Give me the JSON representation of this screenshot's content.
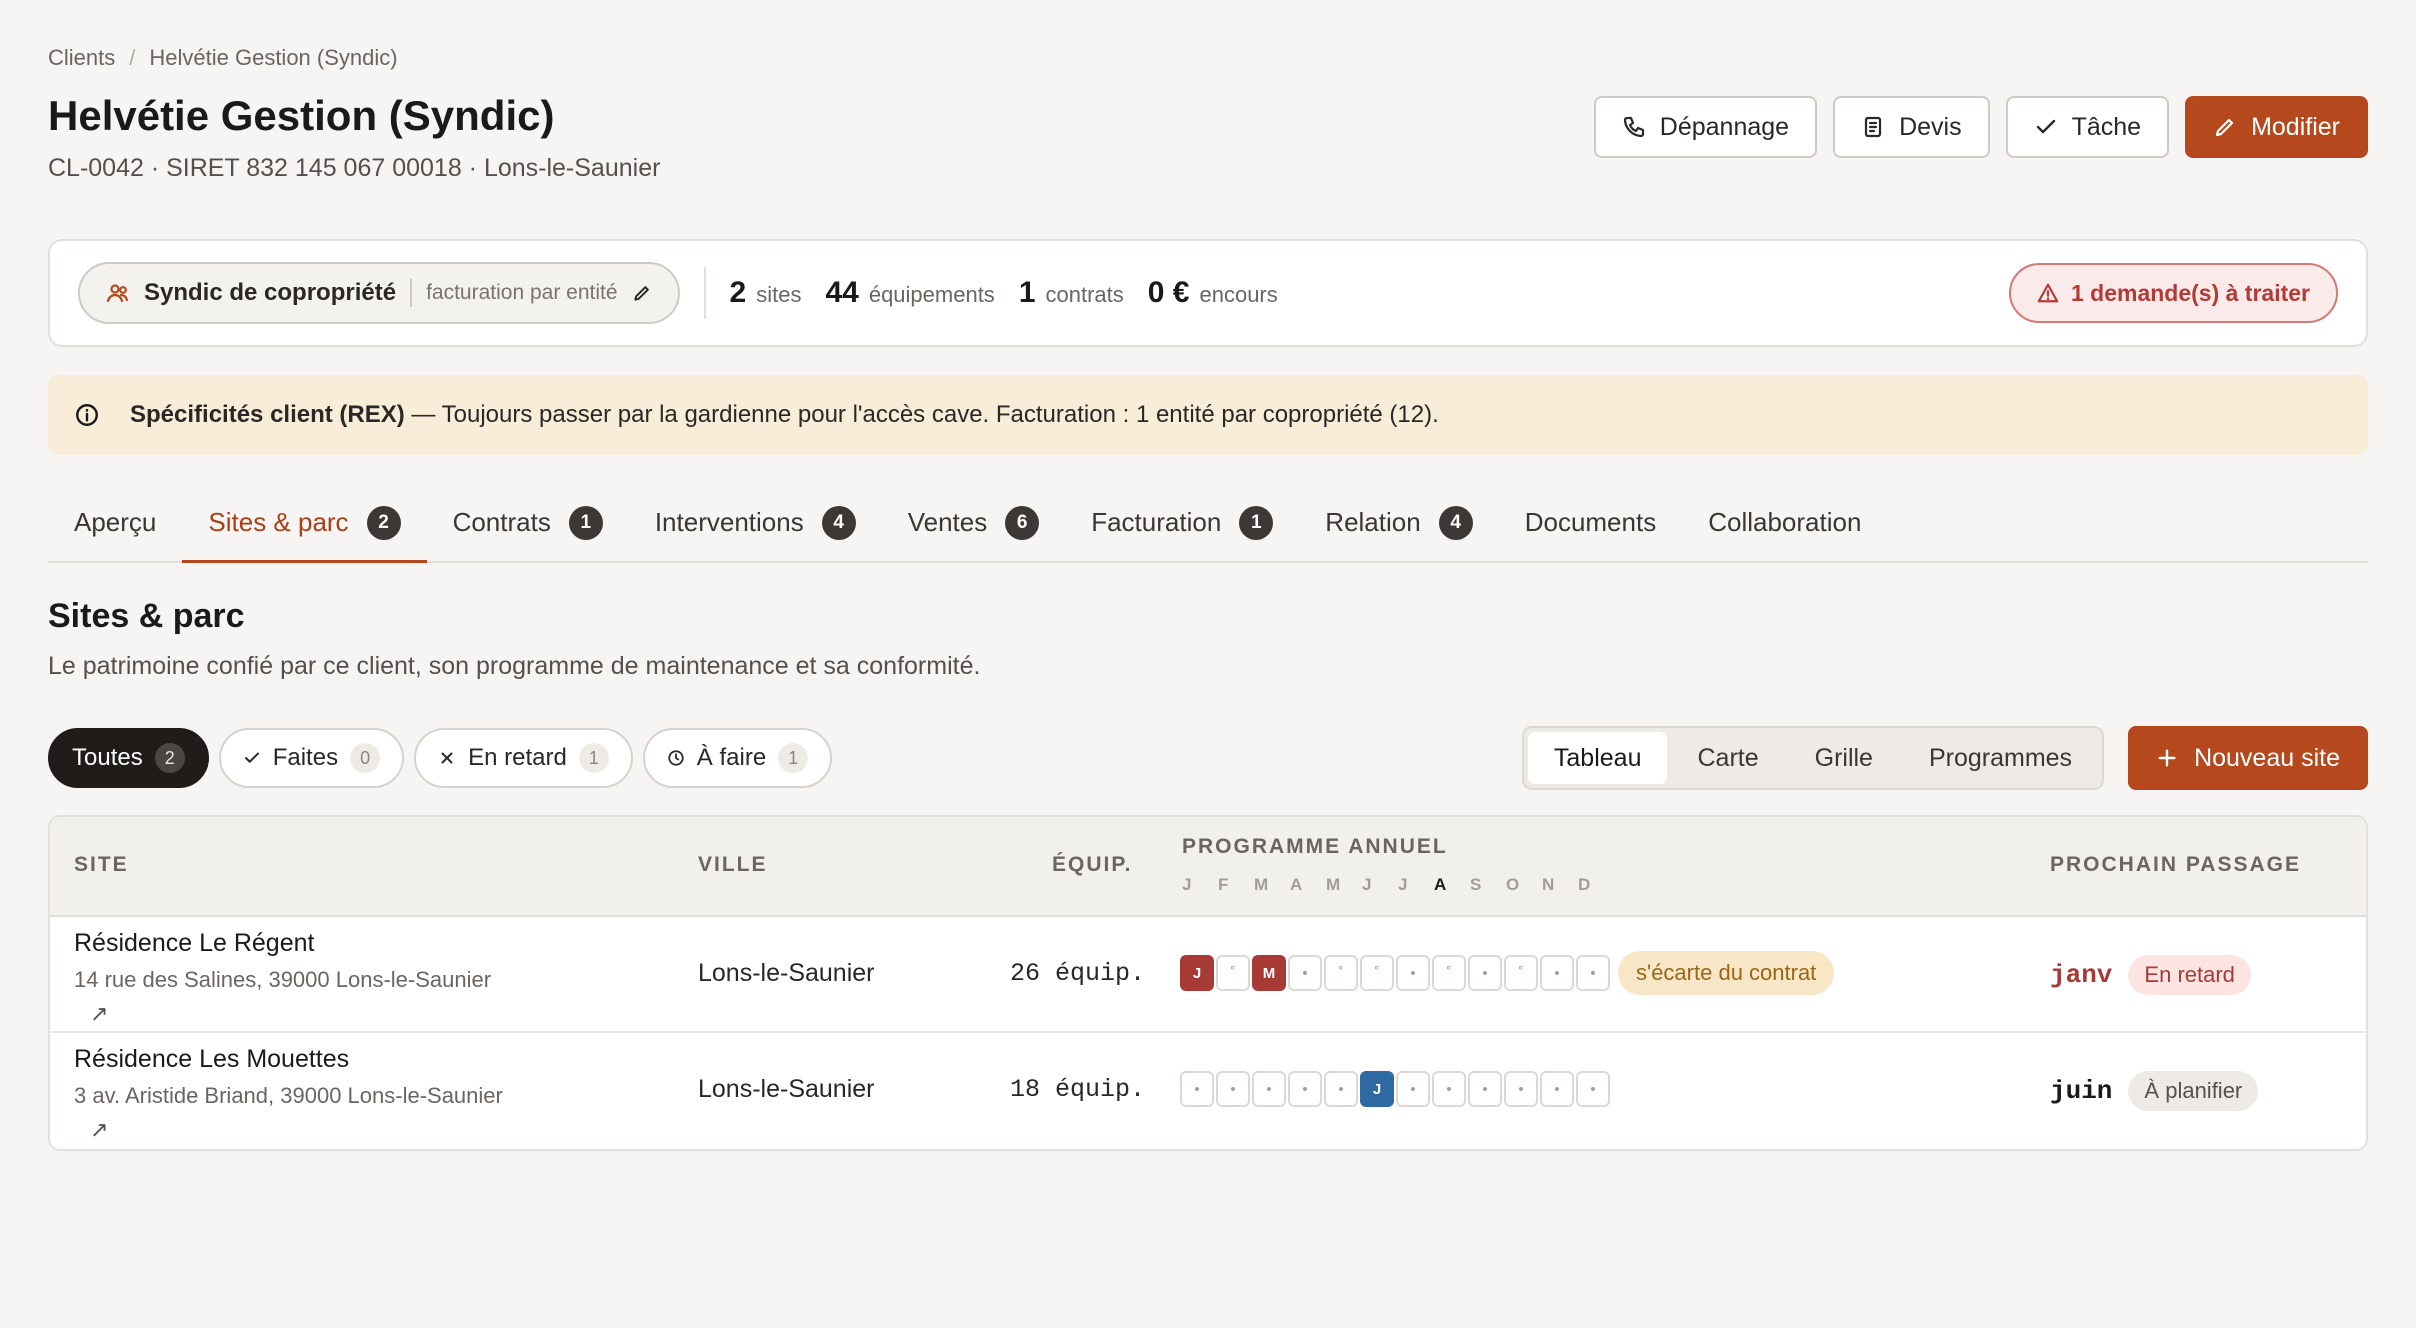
{
  "breadcrumb": [
    "Clients",
    "Helvétie Gestion (Syndic)"
  ],
  "client": {
    "name": "Helvétie Gestion (Syndic)",
    "meta": "CL-0042 · SIRET 832 145 067 00018 · Lons-le-Saunier"
  },
  "actions": {
    "depannage": "Dépannage",
    "devis": "Devis",
    "tache": "Tâche",
    "modifier": "Modifier"
  },
  "summary": {
    "type_label": "Syndic de copropriété",
    "billing_label": "facturation par entité",
    "stats": [
      {
        "n": "2",
        "u": "sites"
      },
      {
        "n": "44",
        "u": "équipements"
      },
      {
        "n": "1",
        "u": "contrats"
      },
      {
        "n": "0 €",
        "u": "encours"
      }
    ],
    "alert": "1 demande(s) à traiter"
  },
  "rex": {
    "title": "Spécificités client (REX)",
    "text": "— Toujours passer par la gardienne pour l'accès cave. Facturation : 1 entité par copropriété (12)."
  },
  "tabs": [
    {
      "label": "Aperçu",
      "count": ""
    },
    {
      "label": "Sites & parc",
      "count": "2",
      "active": true
    },
    {
      "label": "Contrats",
      "count": "1"
    },
    {
      "label": "Interventions",
      "count": "4"
    },
    {
      "label": "Ventes",
      "count": "6"
    },
    {
      "label": "Facturation",
      "count": "1"
    },
    {
      "label": "Relation",
      "count": "4"
    },
    {
      "label": "Documents",
      "count": ""
    },
    {
      "label": "Collaboration",
      "count": ""
    }
  ],
  "section": {
    "title": "Sites & parc",
    "desc": "Le patrimoine confié par ce client, son programme de maintenance et sa conformité."
  },
  "filters": [
    {
      "label": "Toutes",
      "count": "2",
      "icon": ""
    },
    {
      "label": "Faites",
      "count": "0",
      "icon": "check-icon"
    },
    {
      "label": "En retard",
      "count": "1",
      "icon": "x-icon"
    },
    {
      "label": "À faire",
      "count": "1",
      "icon": "clock-icon"
    }
  ],
  "views": [
    "Tableau",
    "Carte",
    "Grille",
    "Programmes"
  ],
  "new_site": "Nouveau site",
  "table": {
    "headers": {
      "site": "SITE",
      "ville": "VILLE",
      "equip": "ÉQUIP.",
      "programme": "PROGRAMME ANNUEL",
      "prochain": "PROCHAIN PASSAGE"
    },
    "months": [
      "J",
      "F",
      "M",
      "A",
      "M",
      "J",
      "J",
      "A",
      "S",
      "O",
      "N",
      "D"
    ],
    "current_month_index": 7,
    "rows": [
      {
        "site": "Résidence Le Régent",
        "address": "14 rue des Salines, 39000 Lons-le-Saunier",
        "ville": "Lons-le-Saunier",
        "equip": "26 équip.",
        "months": [
          {
            "t": "J",
            "s": "red"
          },
          {
            "t": "˚",
            "s": ""
          },
          {
            "t": "M",
            "s": "red"
          },
          {
            "t": "•",
            "s": ""
          },
          {
            "t": "˚",
            "s": ""
          },
          {
            "t": "˚",
            "s": ""
          },
          {
            "t": "•",
            "s": ""
          },
          {
            "t": "˚",
            "s": ""
          },
          {
            "t": "•",
            "s": ""
          },
          {
            "t": "˚",
            "s": ""
          },
          {
            "t": "•",
            "s": ""
          },
          {
            "t": "•",
            "s": ""
          }
        ],
        "deviation": "s'écarte du contrat",
        "next_month": "janv",
        "next_status": "En retard",
        "status_kind": "late"
      },
      {
        "site": "Résidence Les Mouettes",
        "address": "3 av. Aristide Briand, 39000 Lons-le-Saunier",
        "ville": "Lons-le-Saunier",
        "equip": "18 équip.",
        "months": [
          {
            "t": "•",
            "s": ""
          },
          {
            "t": "•",
            "s": ""
          },
          {
            "t": "•",
            "s": ""
          },
          {
            "t": "•",
            "s": ""
          },
          {
            "t": "•",
            "s": ""
          },
          {
            "t": "J",
            "s": "blue"
          },
          {
            "t": "•",
            "s": ""
          },
          {
            "t": "•",
            "s": ""
          },
          {
            "t": "•",
            "s": ""
          },
          {
            "t": "•",
            "s": ""
          },
          {
            "t": "•",
            "s": ""
          },
          {
            "t": "•",
            "s": ""
          }
        ],
        "deviation": "",
        "next_month": "juin",
        "next_status": "À planifier",
        "status_kind": "plan"
      }
    ]
  },
  "colors": {
    "accent": "#b5481c",
    "late": "#a83a35",
    "planned": "#2f6aa3",
    "warn_bg": "#f8edd8"
  }
}
